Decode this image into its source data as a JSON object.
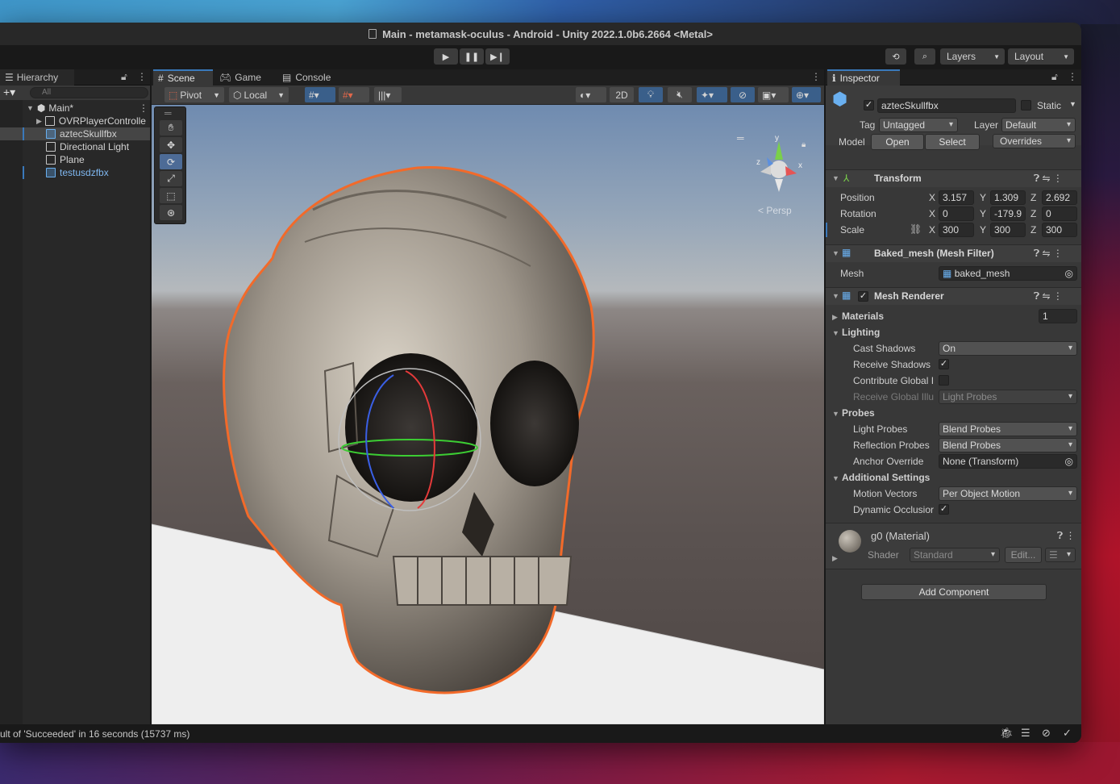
{
  "window": {
    "title": "Main - metamask-oculus - Android - Unity 2022.1.0b6.2664 <Metal>"
  },
  "toolbar": {
    "layers_label": "Layers",
    "layout_label": "Layout"
  },
  "hierarchy": {
    "tab_label": "Hierarchy",
    "search_placeholder": "All",
    "scene_name": "Main*",
    "items": [
      {
        "label": "OVRPlayerControlle"
      },
      {
        "label": "aztecSkullfbx"
      },
      {
        "label": "Directional Light"
      },
      {
        "label": "Plane"
      },
      {
        "label": "testusdzfbx"
      }
    ]
  },
  "scene": {
    "tabs": [
      {
        "label": "Scene"
      },
      {
        "label": "Game"
      },
      {
        "label": "Console"
      }
    ],
    "pivot_label": "Pivot",
    "local_label": "Local",
    "mode_2d": "2D",
    "persp_label": "< Persp",
    "gizmo_axes": {
      "x": "x",
      "y": "y",
      "z": "z"
    }
  },
  "inspector": {
    "tab_label": "Inspector",
    "object_name": "aztecSkullfbx",
    "static_label": "Static",
    "tag_label": "Tag",
    "tag_value": "Untagged",
    "layer_label": "Layer",
    "layer_value": "Default",
    "model_label": "Model",
    "open_label": "Open",
    "select_label": "Select",
    "overrides_label": "Overrides",
    "transform": {
      "title": "Transform",
      "position_label": "Position",
      "rotation_label": "Rotation",
      "scale_label": "Scale",
      "position": {
        "x": "3.157",
        "y": "1.309",
        "z": "2.692"
      },
      "rotation": {
        "x": "0",
        "y": "-179.9",
        "z": "0"
      },
      "scale": {
        "x": "300",
        "y": "300",
        "z": "300"
      },
      "axis_x": "X",
      "axis_y": "Y",
      "axis_z": "Z"
    },
    "mesh_filter": {
      "title": "Baked_mesh (Mesh Filter)",
      "mesh_label": "Mesh",
      "mesh_value": "baked_mesh"
    },
    "mesh_renderer": {
      "title": "Mesh Renderer",
      "materials_label": "Materials",
      "materials_count": "1",
      "lighting_label": "Lighting",
      "cast_shadows_label": "Cast Shadows",
      "cast_shadows_value": "On",
      "receive_shadows_label": "Receive Shadows",
      "contribute_gi_label": "Contribute Global I",
      "receive_gi_label": "Receive Global Illu",
      "receive_gi_value": "Light Probes",
      "probes_label": "Probes",
      "light_probes_label": "Light Probes",
      "light_probes_value": "Blend Probes",
      "reflection_probes_label": "Reflection Probes",
      "reflection_probes_value": "Blend Probes",
      "anchor_override_label": "Anchor Override",
      "anchor_override_value": "None (Transform)",
      "additional_settings_label": "Additional Settings",
      "motion_vectors_label": "Motion Vectors",
      "motion_vectors_value": "Per Object Motion",
      "dynamic_occlusion_label": "Dynamic Occlusior"
    },
    "material": {
      "title": "g0 (Material)",
      "shader_label": "Shader",
      "shader_value": "Standard",
      "edit_label": "Edit..."
    },
    "add_component_label": "Add Component"
  },
  "status": {
    "message": "ult of 'Succeeded' in 16 seconds (15737 ms)"
  },
  "colors": {
    "accent": "#3a79bb",
    "selection_outline": "#f26a2a"
  }
}
